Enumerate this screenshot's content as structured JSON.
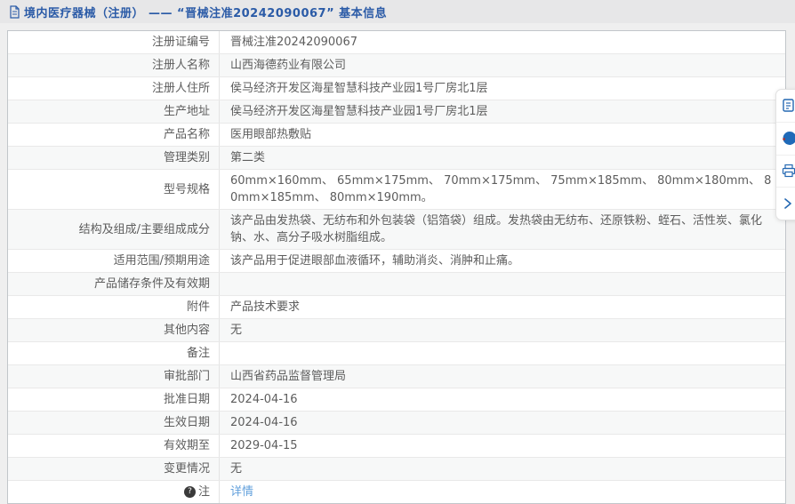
{
  "header": {
    "icon": "document-icon",
    "title": "境内医疗器械（注册） —— “晋械注准20242090067” 基本信息"
  },
  "table": {
    "rows": [
      {
        "label": "注册证编号",
        "value": "晋械注准20242090067"
      },
      {
        "label": "注册人名称",
        "value": "山西海德药业有限公司"
      },
      {
        "label": "注册人住所",
        "value": "侯马经济开发区海星智慧科技产业园1号厂房北1层"
      },
      {
        "label": "生产地址",
        "value": "侯马经济开发区海星智慧科技产业园1号厂房北1层"
      },
      {
        "label": "产品名称",
        "value": "医用眼部热敷贴"
      },
      {
        "label": "管理类别",
        "value": "第二类"
      },
      {
        "label": "型号规格",
        "value": "60mm×160mm、 65mm×175mm、 70mm×175mm、 75mm×185mm、 80mm×180mm、 80mm×185mm、 80mm×190mm。"
      },
      {
        "label": "结构及组成/主要组成成分",
        "value": "该产品由发热袋、无纺布和外包装袋（铝箔袋）组成。发热袋由无纺布、还原铁粉、蛭石、活性炭、氯化钠、水、高分子吸水树脂组成。"
      },
      {
        "label": "适用范围/预期用途",
        "value": "该产品用于促进眼部血液循环，辅助消炎、消肿和止痛。"
      },
      {
        "label": "产品储存条件及有效期",
        "value": ""
      },
      {
        "label": "附件",
        "value": "产品技术要求"
      },
      {
        "label": "其他内容",
        "value": "无"
      },
      {
        "label": "备注",
        "value": ""
      },
      {
        "label": "审批部门",
        "value": "山西省药品监督管理局"
      },
      {
        "label": "批准日期",
        "value": "2024-04-16"
      },
      {
        "label": "生效日期",
        "value": "2024-04-16"
      },
      {
        "label": "有效期至",
        "value": "2029-04-15"
      },
      {
        "label": "变更情况",
        "value": "无"
      }
    ],
    "note_row": {
      "icon": "note-badge-icon",
      "icon_glyph": "?",
      "label": "注",
      "link_text": "详情"
    }
  },
  "side_toolbar": {
    "icons": [
      {
        "name": "file-icon"
      },
      {
        "name": "badge-circle-icon"
      },
      {
        "name": "printer-icon"
      },
      {
        "name": "chevron-right-icon"
      }
    ]
  },
  "colors": {
    "header_text": "#2b5ba7",
    "body_text": "#5d5d5d",
    "link": "#62a0dc",
    "toolbar_icon": "#2468b2",
    "zebra_row": "#f7f8f8"
  }
}
